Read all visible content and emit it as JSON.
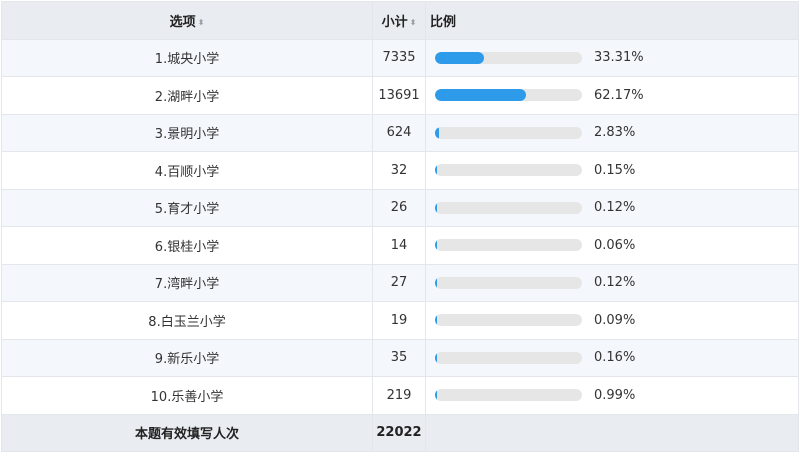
{
  "header": {
    "option_label": "选项",
    "count_label": "小计",
    "ratio_label": "比例",
    "sort_icon": "sort-updown-icon"
  },
  "rows": [
    {
      "option": "1.城央小学",
      "count": "7335",
      "percent": "33.31%",
      "fraction": 0.3331
    },
    {
      "option": "2.湖畔小学",
      "count": "13691",
      "percent": "62.17%",
      "fraction": 0.6217
    },
    {
      "option": "3.景明小学",
      "count": "624",
      "percent": "2.83%",
      "fraction": 0.0283
    },
    {
      "option": "4.百顺小学",
      "count": "32",
      "percent": "0.15%",
      "fraction": 0.0015
    },
    {
      "option": "5.育才小学",
      "count": "26",
      "percent": "0.12%",
      "fraction": 0.0012
    },
    {
      "option": "6.银桂小学",
      "count": "14",
      "percent": "0.06%",
      "fraction": 0.0006
    },
    {
      "option": "7.湾畔小学",
      "count": "27",
      "percent": "0.12%",
      "fraction": 0.0012
    },
    {
      "option": "8.白玉兰小学",
      "count": "19",
      "percent": "0.09%",
      "fraction": 0.0009
    },
    {
      "option": "9.新乐小学",
      "count": "35",
      "percent": "0.16%",
      "fraction": 0.0016
    },
    {
      "option": "10.乐善小学",
      "count": "219",
      "percent": "0.99%",
      "fraction": 0.0099
    }
  ],
  "footer": {
    "label": "本题有效填写人次",
    "total": "22022"
  },
  "colors": {
    "bar_fill": "#2e9bea",
    "bar_track": "#e6e6e6",
    "header_bg": "#e9ecf0",
    "row_alt_bg": "#f4f7fb"
  }
}
